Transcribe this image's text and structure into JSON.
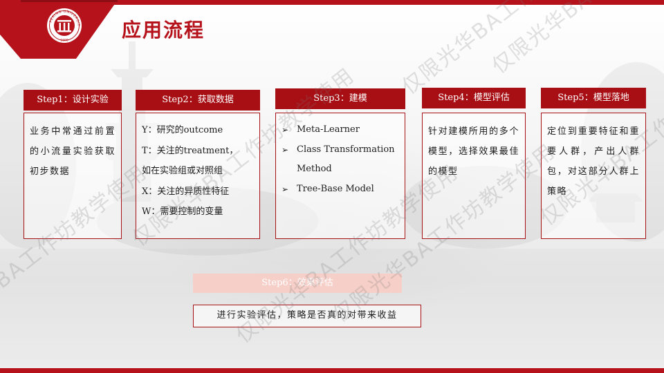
{
  "slide": {
    "title": "应用流程",
    "logo_text": "PEKING UNIVERSITY",
    "logo_year": "1898"
  },
  "steps": [
    {
      "header": "Step1：设计实验",
      "text": "业务中常通过前置的小流量实验获取初步数据"
    },
    {
      "header": "Step2：获取数据",
      "lines": [
        "Y：研究的outcome",
        "T：关注的treatment，",
        "如在实验组或对照组",
        "X：关注的异质性特征",
        "W：需要控制的变量"
      ]
    },
    {
      "header": "Step3：建模",
      "bullets": [
        "Meta-Learner",
        "Class Transformation Method",
        "Tree-Base Model"
      ]
    },
    {
      "header": "Step4：模型评估",
      "text": "针对建模所用的多个模型，选择效果最佳的模型"
    },
    {
      "header": "Step5：模型落地",
      "text": "定位到重要特征和重要人群，产出人群包，对这部分人群上策略"
    }
  ],
  "step6": {
    "header": "Step6：效果评估",
    "text": "进行实验评估，策略是否真的对带来收益"
  },
  "watermark": "仅限光华BA工作坊教学使用",
  "colors": {
    "brand_red": "#b5121b",
    "header_red": "#a80f14",
    "step6_pink": "#f6cfc8"
  },
  "icons": {
    "bullet": "arrow-bullet-icon",
    "logo": "peking-university-seal"
  }
}
